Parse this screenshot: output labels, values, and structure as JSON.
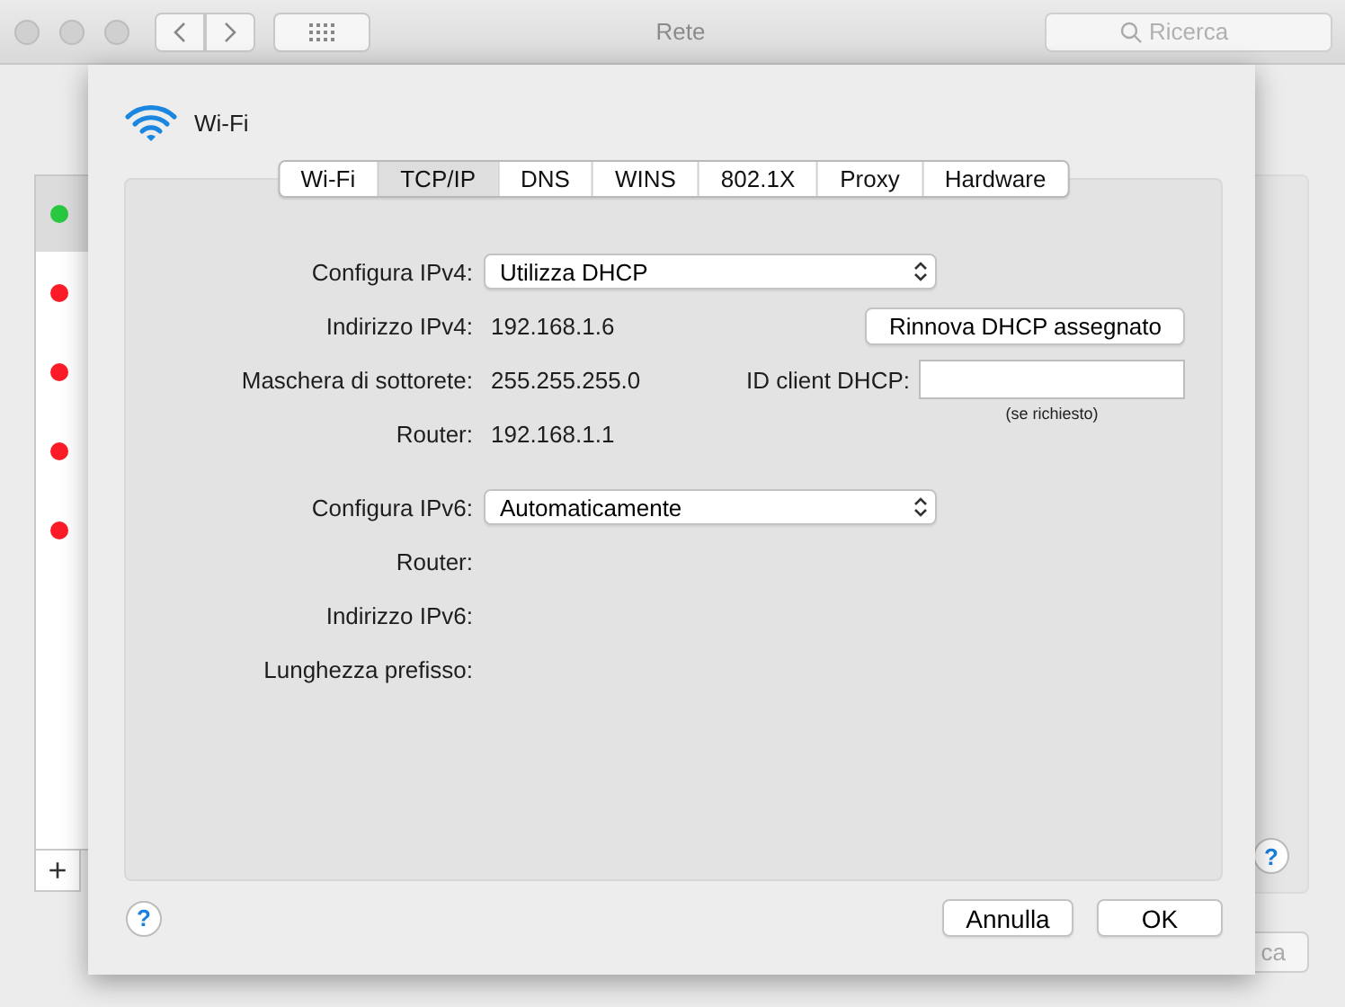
{
  "window": {
    "title": "Rete",
    "search": {
      "placeholder": "Ricerca"
    }
  },
  "sidebar": {
    "items": [
      {
        "color": "#28c840",
        "selected": true
      },
      {
        "color": "#fc1c27",
        "selected": false
      },
      {
        "color": "#fc1c27",
        "selected": false
      },
      {
        "color": "#fc1c27",
        "selected": false
      },
      {
        "color": "#fc1c27",
        "selected": false
      }
    ],
    "add_button": "+"
  },
  "background_help": "?",
  "background_apply": "ca",
  "sheet": {
    "title": "Wi-Fi",
    "tabs": [
      {
        "label": "Wi-Fi",
        "selected": false
      },
      {
        "label": "TCP/IP",
        "selected": true
      },
      {
        "label": "DNS",
        "selected": false
      },
      {
        "label": "WINS",
        "selected": false
      },
      {
        "label": "802.1X",
        "selected": false
      },
      {
        "label": "Proxy",
        "selected": false
      },
      {
        "label": "Hardware",
        "selected": false
      }
    ],
    "ipv4_rows": [
      {
        "kind": "select",
        "label": "Configura IPv4:",
        "value": "Utilizza DHCP"
      },
      {
        "kind": "value",
        "label": "Indirizzo IPv4:",
        "value": "192.168.1.6",
        "button": "Rinnova DHCP assegnato"
      },
      {
        "kind": "value",
        "label": "Maschera di sottorete:",
        "value": "255.255.255.0",
        "field_label": "ID client DHCP:",
        "field_hint": "(se richiesto)"
      },
      {
        "kind": "value",
        "label": "Router:",
        "value": "192.168.1.1"
      }
    ],
    "ipv6_rows": [
      {
        "kind": "select",
        "label": "Configura IPv6:",
        "value": "Automaticamente"
      },
      {
        "kind": "value",
        "label": "Router:"
      },
      {
        "kind": "value",
        "label": "Indirizzo IPv6:"
      },
      {
        "kind": "value",
        "label": "Lunghezza prefisso:"
      }
    ],
    "help": "?",
    "buttons": [
      {
        "label": "Annulla",
        "kind": "cancel"
      },
      {
        "label": "OK",
        "kind": "ok"
      }
    ]
  }
}
